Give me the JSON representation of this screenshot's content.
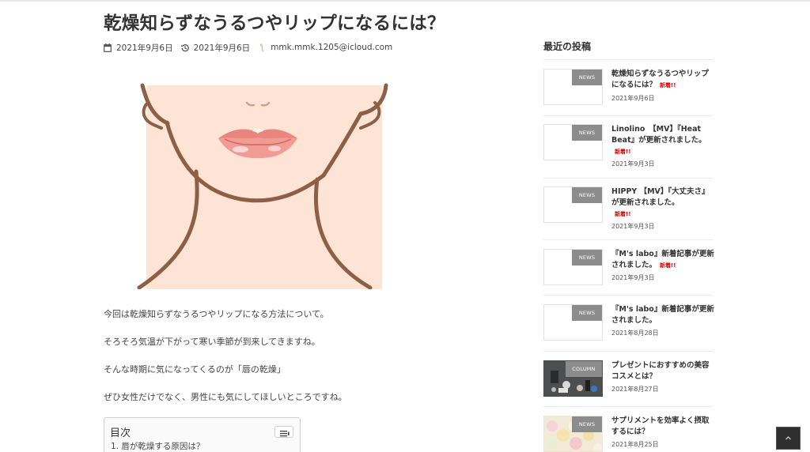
{
  "article": {
    "title": "乾燥知らずなうるつやリップになるには？",
    "published": "2021年9月6日",
    "updated": "2021年9月6日",
    "author": "mmk.mmk.1205@icloud.com",
    "paragraphs": [
      "今回は乾燥知らずなうるつやリップになる方法について。",
      "そろそろ気温が下がって寒い季節が到来してきますね。",
      "そんな時期に気になってくるのが「唇の乾燥」",
      "ぜひ女性だけでなく、男性にも気にしてほしいところですね。"
    ],
    "toc": {
      "title": "目次",
      "first_item": "1. 唇が乾燥する原因は？"
    }
  },
  "sidebar": {
    "heading": "最近の投稿",
    "new_label": "新着!!",
    "posts": [
      {
        "badge": "NEWS",
        "title": "乾燥知らずなうるつやリップになるには？",
        "is_new": true,
        "date": "2021年9月6日"
      },
      {
        "badge": "NEWS",
        "title": "Linolino　【MV】『Heat Beat』が更新されました。",
        "is_new": true,
        "date": "2021年9月3日"
      },
      {
        "badge": "NEWS",
        "title": "HIPPY 【MV】『大丈夫さ』が更新されました。",
        "is_new": true,
        "date": "2021年9月3日"
      },
      {
        "badge": "NEWS",
        "title": "『M's labo』新着記事が更新されました。",
        "is_new": true,
        "date": "2021年9月3日"
      },
      {
        "badge": "NEWS",
        "title": "『M's labo』新着記事が更新されました。",
        "is_new": false,
        "date": "2021年8月28日"
      },
      {
        "badge": "COLUMN",
        "title": "プレゼントにおすすめの美容コスメとは？",
        "is_new": false,
        "date": "2021年8月27日"
      },
      {
        "badge": "NEWS",
        "title": "サプリメントを効率よく摂取するには？",
        "is_new": false,
        "date": "2021年8月25日"
      }
    ]
  },
  "icons": {
    "published": "calendar-icon",
    "updated": "history-icon",
    "author": "user-avatar-icon",
    "toc_toggle": "list-toggle-icon",
    "page_top": "chevron-up-icon"
  },
  "colors": {
    "badge": "#8c8c8c",
    "new_mark": "#e00000",
    "text": "#333333",
    "page_top_bg": "#2f2f2f"
  }
}
